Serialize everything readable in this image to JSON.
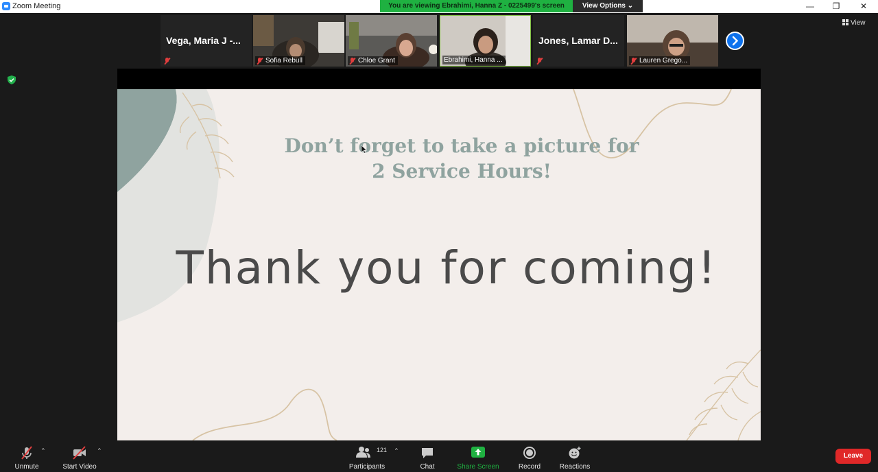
{
  "window": {
    "title": "Zoom Meeting",
    "viewing_banner": "You are viewing Ebrahimi, Hanna Z - 0225499's screen",
    "view_options": "View Options ⌄",
    "controls": {
      "minimize": "—",
      "restore": "❐",
      "close": "✕"
    }
  },
  "participants_strip": [
    {
      "name": "Vega, Maria J -...",
      "label": "",
      "video": false
    },
    {
      "name": "",
      "label": "Sofia Rebull",
      "video": true
    },
    {
      "name": "",
      "label": "Chloe Grant",
      "video": true
    },
    {
      "name": "",
      "label": "Ebrahimi, Hanna ...",
      "video": true,
      "active_speaker": true
    },
    {
      "name": "Jones, Lamar D...",
      "label": "",
      "video": false
    },
    {
      "name": "",
      "label": "Lauren Grego...",
      "video": true
    }
  ],
  "view_button": "View",
  "slide": {
    "subtitle_line1": "Don’t forget to take a picture for",
    "subtitle_line2": "2 Service Hours!",
    "headline": "Thank you for coming!"
  },
  "toolbar": {
    "unmute": "Unmute",
    "start_video": "Start Video",
    "participants": "Participants",
    "participants_count": "121",
    "chat": "Chat",
    "share_screen": "Share Screen",
    "record": "Record",
    "reactions": "Reactions",
    "leave": "Leave",
    "caret": "^"
  },
  "colors": {
    "share_green": "#1fb141",
    "leave_red": "#e02828",
    "accent_blue": "#0e72ed",
    "slide_bg": "#f3eeeb"
  }
}
